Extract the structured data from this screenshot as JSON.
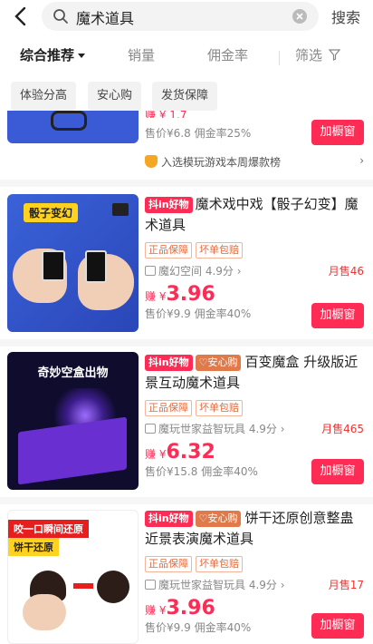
{
  "search": {
    "query": "魔术道具",
    "button": "搜索"
  },
  "sort_tabs": [
    "综合推荐",
    "销量",
    "佣金率",
    "筛选"
  ],
  "chips": [
    "体验分高",
    "安心购",
    "发货保障"
  ],
  "partial_card": {
    "earn_partial": "赚 ¥ 1.7",
    "price": "售价¥6.8",
    "commission": "佣金率25%",
    "add_label": "加橱窗",
    "ranking": "入选模玩游戏本周爆款榜"
  },
  "products": [
    {
      "badges": [
        "抖in好物"
      ],
      "title": "魔术戏中戏【骰子幻变】魔术道具",
      "image_caption": "骰子变幻",
      "tags": [
        "正品保障",
        "坏单包赔"
      ],
      "shop": "魔幻空间 4.9分",
      "monthly": "月售46",
      "earn_prefix": "赚",
      "earn_currency": "¥",
      "earn_value": "3.96",
      "price": "售价¥9.9",
      "commission": "佣金率40%",
      "add_label": "加橱窗"
    },
    {
      "badges": [
        "抖in好物",
        "安心购"
      ],
      "title": "百变魔盒 升级版近景互动魔术道具",
      "image_caption": "奇妙空盒出物",
      "tags": [
        "正品保障",
        "坏单包赔"
      ],
      "shop": "魔玩世家益智玩具 4.9分",
      "monthly": "月售465",
      "earn_prefix": "赚",
      "earn_currency": "¥",
      "earn_value": "6.32",
      "price": "售价¥15.8",
      "commission": "佣金率40%",
      "add_label": "加橱窗"
    },
    {
      "badges": [
        "抖in好物",
        "安心购"
      ],
      "title": "饼干还原创意整蛊近景表演魔术道具",
      "image_caption": "咬一口瞬间还原",
      "image_caption2": "饼干还原",
      "tags": [
        "正品保障",
        "坏单包赔"
      ],
      "shop": "魔玩世家益智玩具 4.9分",
      "monthly": "月售17",
      "earn_prefix": "赚",
      "earn_currency": "¥",
      "earn_value": "3.96",
      "price": "售价¥9.9",
      "commission": "佣金率40%",
      "add_label": "加橱窗"
    }
  ],
  "colors": {
    "brand": "#fe2c55",
    "tag": "#e56a3a",
    "monthly": "#e33333"
  }
}
